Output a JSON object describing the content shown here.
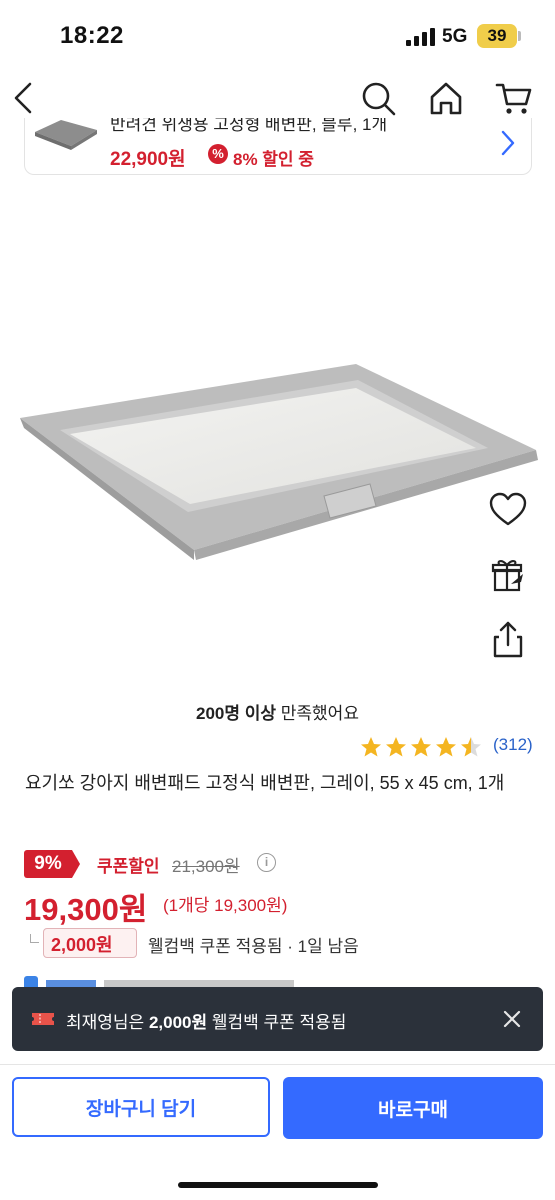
{
  "status_bar": {
    "time": "18:22",
    "network": "5G",
    "battery": "39"
  },
  "nav": {
    "icons": [
      "back-icon",
      "search-icon",
      "home-icon",
      "cart-icon"
    ]
  },
  "recommendation": {
    "cut_text": "반려견 위생용 고정형 배변판, 블루, 1개",
    "price": "22,900원",
    "discount_symbol": "%",
    "discount_text": "8% 할인 중"
  },
  "product": {
    "satisfaction_bold": "200명 이상",
    "satisfaction_rest": " 만족했어요",
    "rating": 4.5,
    "review_count": "(312)",
    "title": "요기쏘 강아지 배변패드 고정식 배변판, 그레이, 55 x 45 cm, 1개",
    "discount_badge": "9%",
    "coupon_label": "쿠폰할인",
    "original_price": "21,300원",
    "info_icon": "i",
    "price": "19,300원",
    "unit_price": "(1개당 19,300원)",
    "welcome_amount": "2,000원",
    "welcome_text": "웰컴백 쿠폰 적용됨 · 1일 남음"
  },
  "toast": {
    "prefix": "최재영님은 ",
    "amount": "2,000원",
    "suffix": " 웰컴백 쿠폰 적용됨"
  },
  "actions": {
    "add_to_cart": "장바구니 담기",
    "buy_now": "바로구매"
  },
  "colors": {
    "accent": "#346aff",
    "sale": "#d3202f",
    "toast_bg": "#2b313a",
    "star": "#f4b521"
  }
}
